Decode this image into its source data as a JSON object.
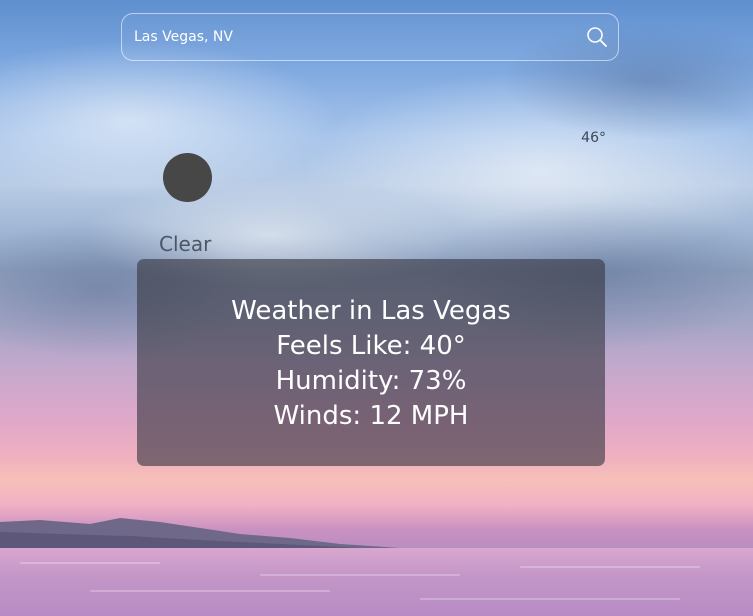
{
  "search": {
    "value": "Las Vegas, NV",
    "icon": "search-icon"
  },
  "current": {
    "temperature": "46°",
    "condition": "Clear",
    "icon": "clear-weather-icon",
    "icon_color": "#474747"
  },
  "details": {
    "title": "Weather in Las Vegas",
    "feels_like": "Feels Like: 40°",
    "humidity": "Humidity: 73%",
    "winds": "Winds: 12 MPH"
  }
}
